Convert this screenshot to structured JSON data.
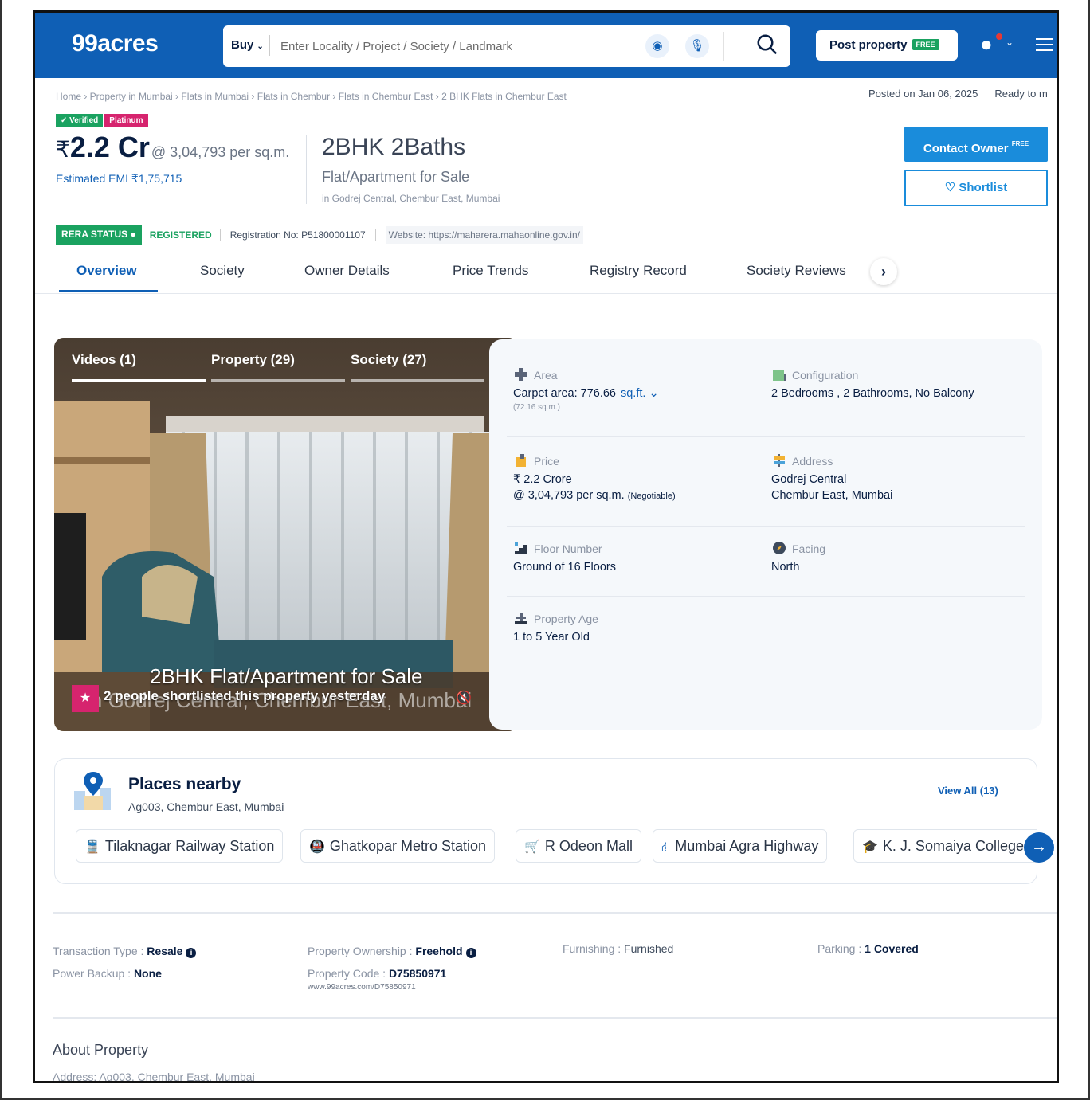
{
  "header": {
    "logo": "99acres",
    "buy_label": "Buy",
    "search_placeholder": "Enter Locality / Project / Society / Landmark",
    "post_property": "Post property",
    "free_tag": "FREE"
  },
  "breadcrumb": "Home › Property in Mumbai › Flats in Mumbai › Flats in Chembur › Flats in Chembur East › 2 BHK Flats in Chembur East",
  "posted": {
    "date": "Posted on Jan 06, 2025",
    "status": "Ready to m"
  },
  "badges": {
    "verified": "✓ Verified",
    "tier": "Platinum"
  },
  "price": {
    "symbol": "₹",
    "amount": "2.2 Cr",
    "per_sqm": "@ 3,04,793 per sq.m.",
    "emi": "Estimated EMI ₹1,75,715"
  },
  "listing": {
    "config": "2BHK 2Baths",
    "type": "Flat/Apartment for Sale",
    "location": "in Godrej Central, Chembur East, Mumbai"
  },
  "actions": {
    "contact": "Contact Owner",
    "contact_tag": "FREE",
    "shortlist": "Shortlist"
  },
  "rera": {
    "status": "RERA STATUS",
    "registered": "REGISTERED",
    "reg_no": "Registration No: P51800001107",
    "website": "Website: https://maharera.mahaonline.gov.in/"
  },
  "tabs": [
    "Overview",
    "Society",
    "Owner Details",
    "Price Trends",
    "Registry Record",
    "Society Reviews"
  ],
  "photo": {
    "tabs": [
      "Videos (1)",
      "Property (29)",
      "Society (27)"
    ],
    "title": "2BHK Flat/Apartment for Sale",
    "location": "in Godrej Central, Chembur East, Mumbai",
    "shortlisted": "2 people shortlisted this property yesterday"
  },
  "details": {
    "area": {
      "label": "Area",
      "value": "Carpet area: 776.66",
      "unit": "sq.ft.",
      "sub": "(72.16 sq.m.)"
    },
    "configuration": {
      "label": "Configuration",
      "value": "2 Bedrooms , 2 Bathrooms, No Balcony"
    },
    "price": {
      "label": "Price",
      "value": "₹ 2.2 Crore",
      "value2": "@ 3,04,793 per sq.m.",
      "negotiable": "(Negotiable)"
    },
    "address": {
      "label": "Address",
      "value": "Godrej Central",
      "value2": "Chembur East, Mumbai"
    },
    "floor": {
      "label": "Floor Number",
      "value": "Ground of 16 Floors"
    },
    "facing": {
      "label": "Facing",
      "value": "North"
    },
    "age": {
      "label": "Property Age",
      "value": "1 to 5 Year Old"
    }
  },
  "nearby": {
    "title": "Places nearby",
    "address": "Ag003, Chembur East, Mumbai",
    "view_all": "View All (13)",
    "places": [
      "Tilaknagar Railway Station",
      "Ghatkopar Metro Station",
      "R Odeon Mall",
      "Mumbai Agra Highway",
      "K. J. Somaiya College"
    ]
  },
  "meta": {
    "transaction_label": "Transaction Type : ",
    "transaction": "Resale",
    "ownership_label": "Property Ownership : ",
    "ownership": "Freehold",
    "furnishing_label": "Furnishing : ",
    "furnishing": "Furnished",
    "parking_label": "Parking : ",
    "parking": "1 Covered",
    "backup_label": "Power Backup : ",
    "backup": "None",
    "code_label": "Property Code : ",
    "code": "D75850971",
    "code_url": "www.99acres.com/D75850971"
  },
  "about": {
    "title": "About Property",
    "address": "Address: Ag003, Chembur East, Mumbai"
  },
  "colors": {
    "brand": "#0f5fb5",
    "contact": "#1a8cdb",
    "green": "#1aa260",
    "pink": "#d6246e"
  }
}
